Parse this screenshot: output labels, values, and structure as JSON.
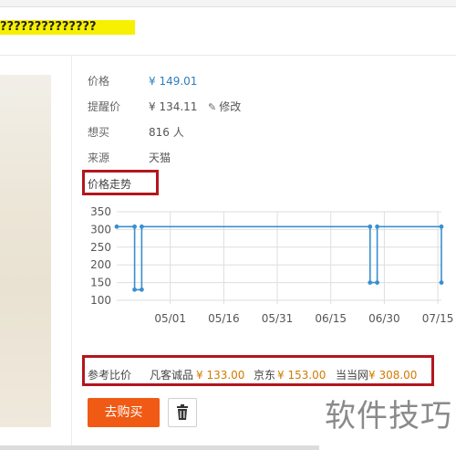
{
  "header": {
    "title": "??????????????"
  },
  "info": {
    "price_label": "价格",
    "price_value": "¥ 149.01",
    "alert_label": "提醒价",
    "alert_value": "¥ 134.11",
    "edit_label": "修改",
    "want_label": "想买",
    "want_value": "816 人",
    "source_label": "来源",
    "source_value": "天猫"
  },
  "trend": {
    "label": "价格走势"
  },
  "chart_data": {
    "type": "line",
    "x_tick_labels": [
      "05/01",
      "05/16",
      "05/31",
      "06/15",
      "06/30",
      "07/15"
    ],
    "y_ticks": [
      100,
      150,
      200,
      250,
      300,
      350
    ],
    "ylim": [
      100,
      350
    ],
    "series": [
      {
        "values": [
          {
            "x": "04/16",
            "y": 308
          },
          {
            "x": "04/21",
            "y": 308
          },
          {
            "x": "04/21",
            "y": 130
          },
          {
            "x": "04/23",
            "y": 130
          },
          {
            "x": "04/23",
            "y": 308
          },
          {
            "x": "06/26",
            "y": 308
          },
          {
            "x": "06/26",
            "y": 150
          },
          {
            "x": "06/28",
            "y": 150
          },
          {
            "x": "06/28",
            "y": 308
          },
          {
            "x": "07/16",
            "y": 308
          },
          {
            "x": "07/16",
            "y": 150
          }
        ],
        "color": "#3a8fd0"
      }
    ],
    "grid": true,
    "xlabel": "",
    "ylabel": ""
  },
  "reference": {
    "label": "参考比价",
    "stores": [
      {
        "name": "凡客诚品",
        "price": "¥ 133.00"
      },
      {
        "name": "京东",
        "price": "¥ 153.00"
      },
      {
        "name": "当当网",
        "price": "¥ 308.00"
      }
    ]
  },
  "actions": {
    "buy_label": "去购买"
  },
  "watermark": {
    "text": "软件技巧"
  },
  "colors": {
    "accent_blue": "#2b7fc0",
    "line_blue": "#3a8fd0",
    "buy_orange": "#f05a14",
    "price_orange": "#d27a00",
    "highlight_red": "#b3161e"
  }
}
